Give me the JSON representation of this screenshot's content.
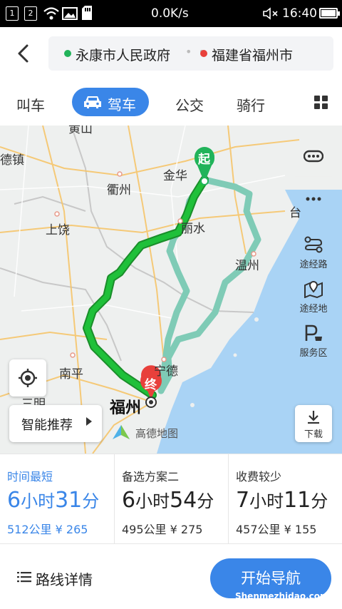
{
  "status_bar": {
    "sim1": "1",
    "sim2": "2",
    "speed": "0.0K/s",
    "time": "16:40"
  },
  "header": {
    "back_icon": "chevron-left-icon",
    "origin": "永康市人民政府",
    "destination": "福建省福州市",
    "origin_color": "#21b35a",
    "destination_color": "#e8403b"
  },
  "tabs": [
    {
      "label": "叫车"
    },
    {
      "label": "驾车",
      "active": true
    },
    {
      "label": "公交"
    },
    {
      "label": "骑行"
    }
  ],
  "map": {
    "cities": [
      "金华",
      "衢州",
      "上饶",
      "丽水",
      "温州",
      "南平",
      "宁德",
      "福州",
      "德镇",
      "台",
      "三明",
      "黄山"
    ],
    "start_marker": "起",
    "end_marker": "终",
    "side_tools": [
      {
        "icon": "traffic-toggle-icon",
        "label": ""
      },
      {
        "icon": "more-icon",
        "label": ""
      },
      {
        "icon": "waypoint-route-icon",
        "label": "途经路"
      },
      {
        "icon": "waypoint-place-icon",
        "label": "途经地"
      },
      {
        "icon": "service-area-icon",
        "label": "服务区"
      }
    ],
    "smart_recommend": "智能推荐",
    "download": "下载",
    "logo": "高德地图"
  },
  "route_options": [
    {
      "tag": "时间最短",
      "hours": "6",
      "h_unit": "小时",
      "minutes": "31",
      "m_unit": "分",
      "distance": "512公里",
      "toll": "¥ 265",
      "selected": true
    },
    {
      "tag": "备选方案二",
      "hours": "6",
      "h_unit": "小时",
      "minutes": "54",
      "m_unit": "分",
      "distance": "495公里",
      "toll": "¥ 275",
      "selected": false
    },
    {
      "tag": "收费较少",
      "hours": "7",
      "h_unit": "小时",
      "minutes": "11",
      "m_unit": "分",
      "distance": "457公里",
      "toll": "¥ 155",
      "selected": false
    }
  ],
  "bottom": {
    "details": "路线详情",
    "start_nav": "开始导航",
    "watermark": "Shenmezhidao.com"
  },
  "colors": {
    "accent": "#3a86e8",
    "route_main": "#1fae2e",
    "route_alt": "#7fcbb6",
    "sea": "#a9d3f5"
  }
}
